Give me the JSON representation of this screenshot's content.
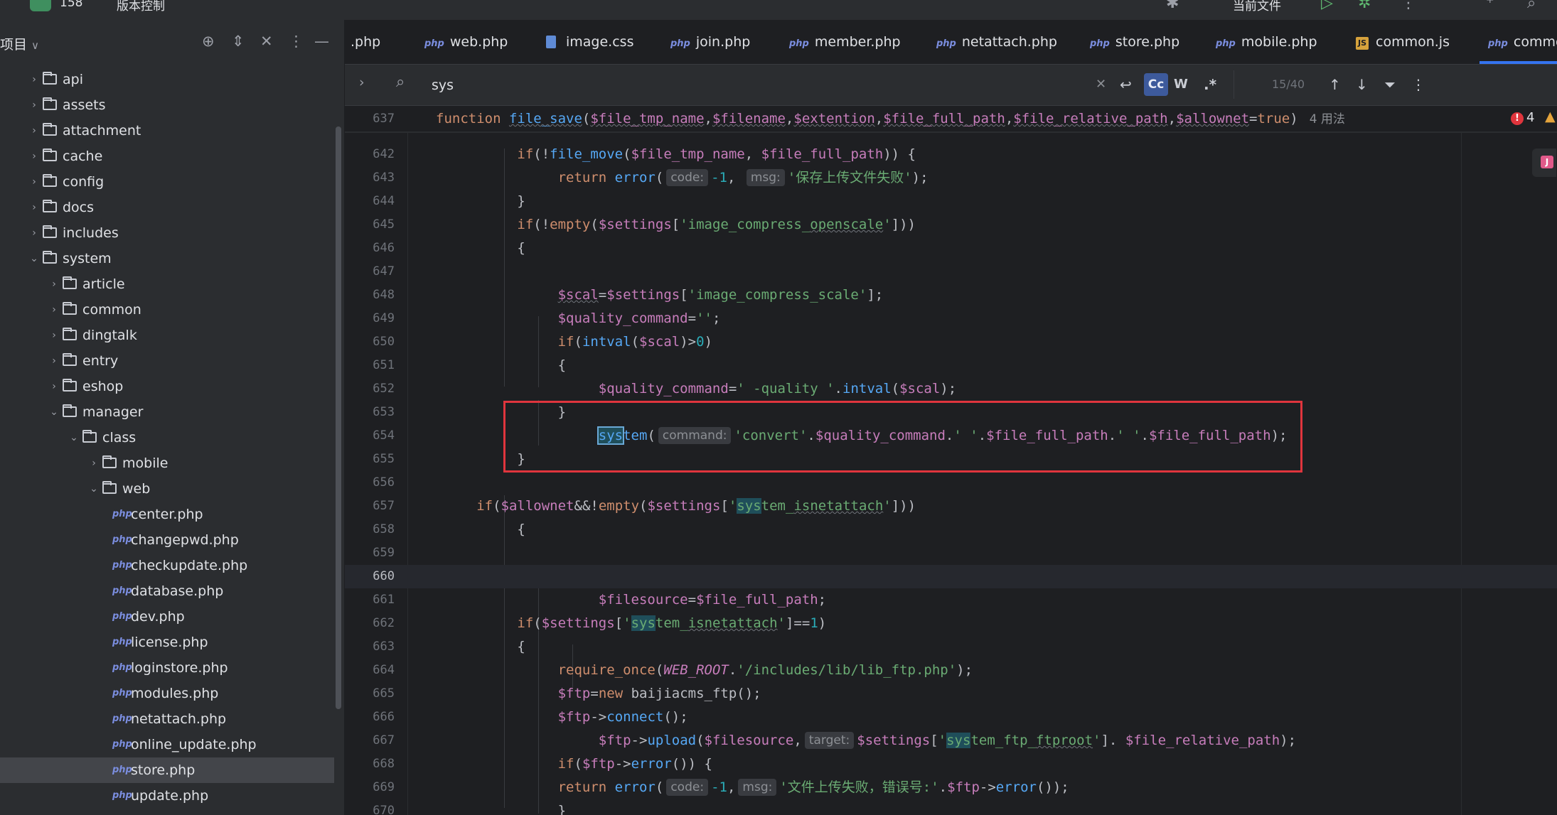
{
  "topbar": {
    "project": "158",
    "vcs": "版本控制",
    "current_file": "当前文件"
  },
  "sidebar": {
    "title": "项目",
    "tree": [
      {
        "depth": 0,
        "label": "api",
        "expanded": false
      },
      {
        "depth": 0,
        "label": "assets",
        "expanded": false
      },
      {
        "depth": 0,
        "label": "attachment",
        "expanded": false
      },
      {
        "depth": 0,
        "label": "cache",
        "expanded": false
      },
      {
        "depth": 0,
        "label": "config",
        "expanded": false
      },
      {
        "depth": 0,
        "label": "docs",
        "expanded": false
      },
      {
        "depth": 0,
        "label": "includes",
        "expanded": false
      },
      {
        "depth": 0,
        "label": "system",
        "expanded": true
      },
      {
        "depth": 1,
        "label": "article",
        "expanded": false
      },
      {
        "depth": 1,
        "label": "common",
        "expanded": false
      },
      {
        "depth": 1,
        "label": "dingtalk",
        "expanded": false
      },
      {
        "depth": 1,
        "label": "entry",
        "expanded": false
      },
      {
        "depth": 1,
        "label": "eshop",
        "expanded": false
      },
      {
        "depth": 1,
        "label": "manager",
        "expanded": true
      },
      {
        "depth": 2,
        "label": "class",
        "expanded": true
      },
      {
        "depth": 3,
        "label": "mobile",
        "expanded": false
      },
      {
        "depth": 3,
        "label": "web",
        "expanded": true
      }
    ],
    "files": [
      "center.php",
      "changepwd.php",
      "checkupdate.php",
      "database.php",
      "dev.php",
      "license.php",
      "loginstore.php",
      "modules.php",
      "netattach.php",
      "online_update.php",
      "store.php",
      "update.php"
    ],
    "selected_file": "store.php",
    "file_icon": "php"
  },
  "tabs": [
    {
      "label": ".php",
      "type": "none"
    },
    {
      "label": "web.php",
      "type": "php"
    },
    {
      "label": "image.css",
      "type": "css"
    },
    {
      "label": "join.php",
      "type": "php"
    },
    {
      "label": "member.php",
      "type": "php"
    },
    {
      "label": "netattach.php",
      "type": "php"
    },
    {
      "label": "store.php",
      "type": "php"
    },
    {
      "label": "mobile.php",
      "type": "php"
    },
    {
      "label": "common.js",
      "type": "js"
    },
    {
      "label": "commo",
      "type": "php",
      "active": true
    }
  ],
  "search": {
    "query": "sys",
    "match_case": "Cc",
    "words": "W",
    "regex": ".*",
    "count": "15/40"
  },
  "editor": {
    "error_count": "4",
    "usages": "4 用法",
    "current_line": "660"
  },
  "hints": {
    "code": "code:",
    "msg": "msg:",
    "command": "command:",
    "target": "target:"
  },
  "strings": {
    "save_fail": "'保存上传文件失败'",
    "upload_fail": "'文件上传失败，错误号:'"
  }
}
